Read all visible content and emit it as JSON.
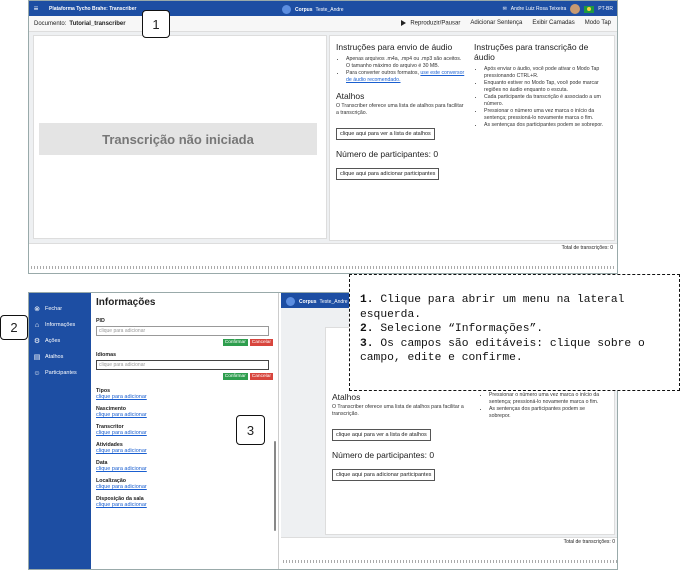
{
  "topbar": {
    "brand": "Plataforma Tycho Brahe: Transcriber",
    "corpus_label": "Corpus",
    "corpus_name": "Teste_Andre",
    "user": "Andre Luiz Rosa Teixeira",
    "lang": "PT-BR"
  },
  "docbar": {
    "label": "Documento:",
    "name": "Tutorial_transcriber",
    "actions": [
      "Reproduzir/Pausar",
      "Adicionar Sentença",
      "Exibir Camadas",
      "Modo Tap"
    ]
  },
  "transcription": {
    "empty": "Transcrição não iniciada"
  },
  "instructions": {
    "upload_title": "Instruções para envio de áudio",
    "upload_items": [
      "Apenas arquivos .m4a, .mp4 ou .mp3 são aceitos. O tamanho máximo do arquivo é 30 MB.",
      "Para converter outros formatos,"
    ],
    "upload_link": "use este conversor de áudio recomendado.",
    "shortcuts_title": "Atalhos",
    "shortcuts_text": "O Transcriber oferece uma lista de atalhos para facilitar a transcrição.",
    "shortcuts_button": "clique aqui para ver a lista de atalhos",
    "participants_title": "Número de participantes: 0",
    "participants_button": "clique aqui para adicionar participantes",
    "transcribe_title": "Instruções para transcrição de áudio",
    "transcribe_items": [
      "Após enviar o áudio, você pode ativar o Modo Tap pressionando CTRL+R.",
      "Enquanto estiver no Modo Tap, você pode marcar regiões no áudio enquanto o escuta.",
      "Cada participante da transcrição é associado a um número.",
      "Pressionar o número uma vez marca o início da sentença; pressioná-lo novamente marca o fim.",
      "As sentenças dos participantes podem se sobrepor."
    ]
  },
  "wave": {
    "total": "Total de transcrições: 0"
  },
  "sidebar": [
    {
      "icon": "close-icon",
      "label": "Fechar"
    },
    {
      "icon": "home-icon",
      "label": "Informações"
    },
    {
      "icon": "actions-icon",
      "label": "Ações"
    },
    {
      "icon": "shortcuts-icon",
      "label": "Atalhos"
    },
    {
      "icon": "participants-icon",
      "label": "Participantes"
    }
  ],
  "drawer": {
    "title": "Informações",
    "pid_label": "PID",
    "pid_placeholder": "clique para adicionar",
    "idiomas_label": "Idiomas",
    "idiomas_placeholder": "clique para adicionar",
    "confirm": "Confirmar",
    "cancel": "Cancelar",
    "fields": [
      {
        "label": "Tipos",
        "value": "clique para adicionar"
      },
      {
        "label": "Nascimento",
        "value": "clique para adicionar"
      },
      {
        "label": "Transcritor",
        "value": "clique para adicionar"
      },
      {
        "label": "Atividades",
        "value": "clique para adicionar"
      },
      {
        "label": "Data",
        "value": "clique para adicionar"
      },
      {
        "label": "Localização",
        "value": "clique para adicionar"
      },
      {
        "label": "Disposição da sala",
        "value": "clique para adicionar"
      }
    ]
  },
  "callouts": [
    "1",
    "2",
    "3"
  ],
  "note": [
    {
      "n": "1.",
      "t": " Clique para abrir um menu na lateral esquerda."
    },
    {
      "n": "2.",
      "t": " Selecione “Informações”."
    },
    {
      "n": "3.",
      "t": " Os campos são editáveis: clique sobre o campo, edite e confirme."
    }
  ]
}
